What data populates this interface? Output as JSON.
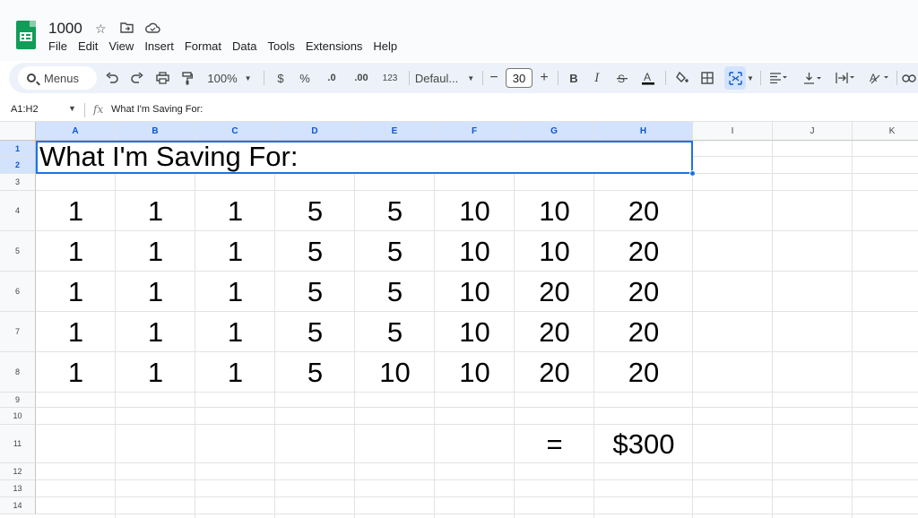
{
  "app": {
    "doc_title": "1000",
    "menus": [
      "File",
      "Edit",
      "View",
      "Insert",
      "Format",
      "Data",
      "Tools",
      "Extensions",
      "Help"
    ]
  },
  "toolbar": {
    "search_label": "Menus",
    "zoom": "100%",
    "currency": "$",
    "percent": "%",
    "dec_decrease": ".0",
    "dec_increase": ".00",
    "number_format": "123",
    "font_family": "Defaul...",
    "font_size": "30"
  },
  "formula_bar": {
    "name_box": "A1:H2",
    "fx": "fx",
    "content": "What I'm Saving For:"
  },
  "grid": {
    "columns": [
      "A",
      "B",
      "C",
      "D",
      "E",
      "F",
      "G",
      "H",
      "I",
      "J",
      "K"
    ],
    "rows": [
      "1",
      "2",
      "3",
      "4",
      "5",
      "6",
      "7",
      "8",
      "9",
      "10",
      "11",
      "12",
      "13",
      "14"
    ],
    "merged_title": "What I'm Saving For:",
    "data_rows": [
      [
        "1",
        "1",
        "1",
        "5",
        "5",
        "10",
        "10",
        "20"
      ],
      [
        "1",
        "1",
        "1",
        "5",
        "5",
        "10",
        "10",
        "20"
      ],
      [
        "1",
        "1",
        "1",
        "5",
        "5",
        "10",
        "20",
        "20"
      ],
      [
        "1",
        "1",
        "1",
        "5",
        "5",
        "10",
        "20",
        "20"
      ],
      [
        "1",
        "1",
        "1",
        "5",
        "10",
        "10",
        "20",
        "20"
      ]
    ],
    "equals": "=",
    "total": "$300"
  },
  "colors": {
    "accent": "#1a73e8",
    "sheets_green": "#0f9d58",
    "toolbar_bg": "#edf2fa",
    "selected_header": "#d3e3fd"
  }
}
